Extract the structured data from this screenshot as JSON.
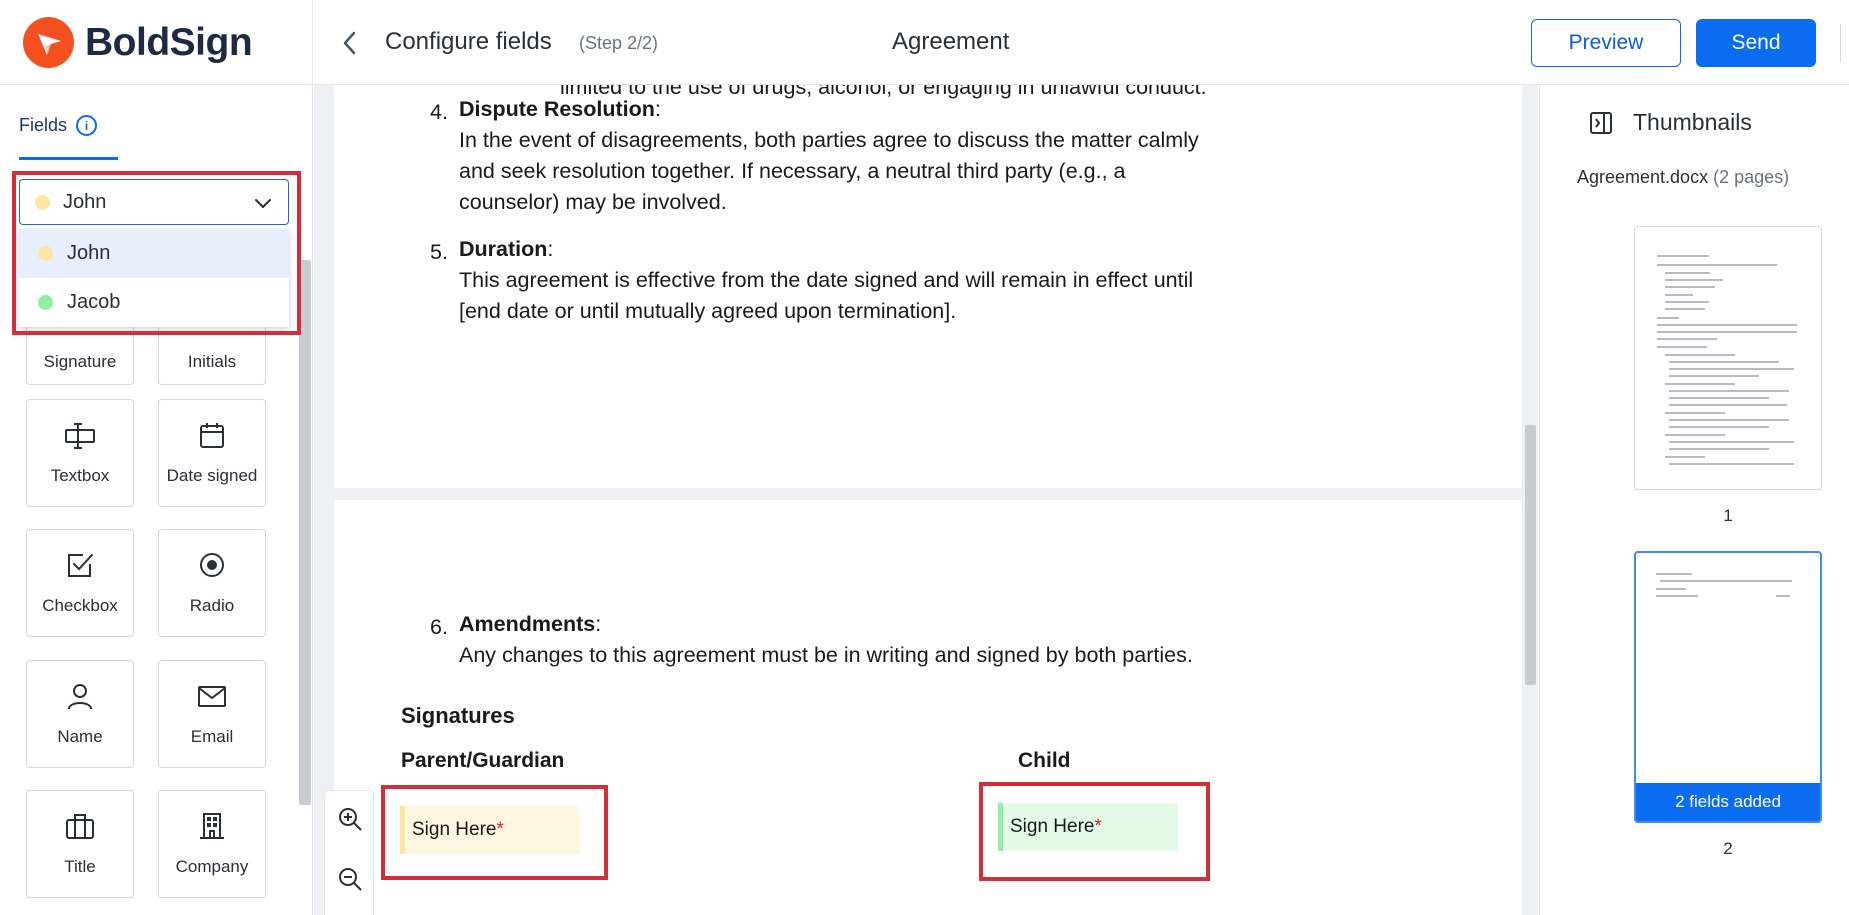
{
  "app": {
    "name": "BoldSign"
  },
  "header": {
    "title": "Configure fields",
    "step": "(Step 2/2)",
    "document": "Agreement",
    "preview_label": "Preview",
    "send_label": "Send"
  },
  "sidebar": {
    "tab_label": "Fields",
    "dropdown": {
      "selected": "John",
      "options": [
        {
          "name": "John",
          "color": "#fbe7a0"
        },
        {
          "name": "Jacob",
          "color": "#8ef0a2"
        }
      ]
    },
    "fields": [
      {
        "label": "Signature",
        "icon": "signature-icon"
      },
      {
        "label": "Initials",
        "icon": "initials-icon"
      },
      {
        "label": "Textbox",
        "icon": "textbox-icon"
      },
      {
        "label": "Date signed",
        "icon": "calendar-icon"
      },
      {
        "label": "Checkbox",
        "icon": "checkbox-icon"
      },
      {
        "label": "Radio",
        "icon": "radio-icon"
      },
      {
        "label": "Name",
        "icon": "person-icon"
      },
      {
        "label": "Email",
        "icon": "envelope-icon"
      },
      {
        "label": "Title",
        "icon": "briefcase-icon"
      },
      {
        "label": "Company",
        "icon": "building-icon"
      }
    ]
  },
  "document": {
    "cutoff_line": "limited to the use of drugs, alcohol, or engaging in unlawful conduct.",
    "sections": [
      {
        "number": "4.",
        "heading": "Dispute Resolution",
        "lines": [
          "In the event of disagreements, both parties agree to discuss the matter calmly",
          "and seek resolution together. If necessary, a neutral third party (e.g., a",
          "counselor) may be involved."
        ]
      },
      {
        "number": "5.",
        "heading": "Duration",
        "lines": [
          "This agreement is effective from the date signed and will remain in effect until",
          "[end date or until mutually agreed upon termination]."
        ]
      },
      {
        "number": "6.",
        "heading": "Amendments",
        "lines": [
          "Any changes to this agreement must be in writing and signed by both parties."
        ]
      }
    ],
    "signatures_heading": "Signatures",
    "parent_label": "Parent/Guardian",
    "child_label": "Child",
    "sign_here": "Sign Here",
    "required_mark": "*",
    "parent_field_color": "#fdf6e1",
    "child_field_color": "#e3fbe6"
  },
  "thumbnails": {
    "title": "Thumbnails",
    "file_name": "Agreement.docx",
    "file_pages": "(2 pages)",
    "pages": [
      {
        "number": "1"
      },
      {
        "number": "2",
        "badge": "2 fields added"
      }
    ]
  },
  "colors": {
    "brand_orange": "#f4511e",
    "accent_blue": "#0a6cf0",
    "highlight_red": "#d62d3a"
  }
}
